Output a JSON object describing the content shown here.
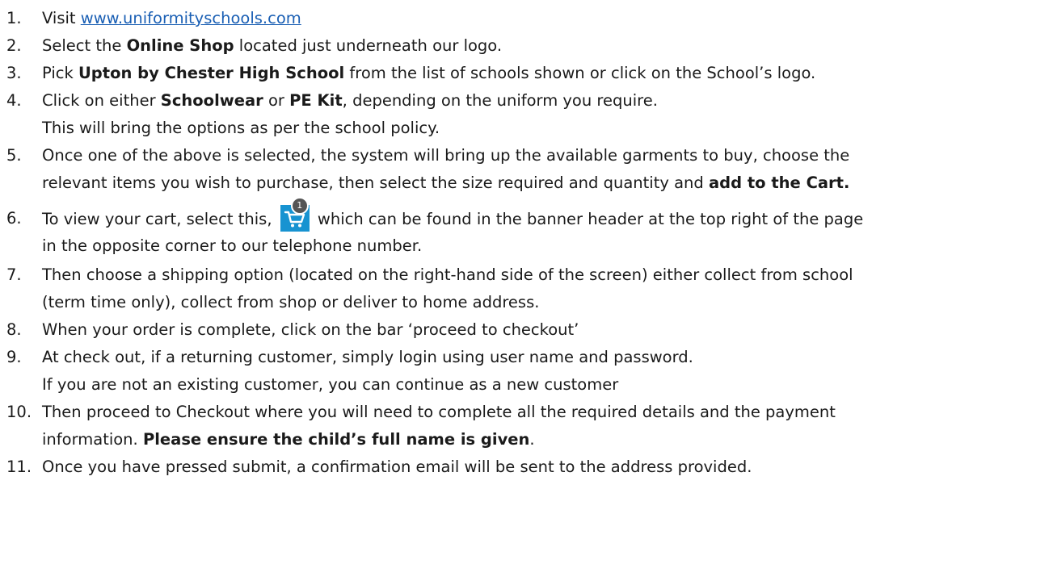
{
  "steps": [
    {
      "num": "1.",
      "pre": "Visit ",
      "link": "www.uniformityschools.com"
    },
    {
      "num": "2.",
      "pre": "Select the ",
      "bold": "Online Shop",
      "post": " located just underneath our logo."
    },
    {
      "num": "3.",
      "pre": "Pick ",
      "bold": "Upton by Chester High School",
      "post": " from the list of schools shown or click on the School’s logo."
    },
    {
      "num": "4.",
      "pre": "Click on either ",
      "bold1": "Schoolwear",
      "mid": " or ",
      "bold2": "PE Kit",
      "post": ", depending on the uniform you require.",
      "line2": "This will bring the options as per the school policy."
    },
    {
      "num": "5.",
      "line1": "Once one of the above is selected, the system will bring up the available garments to buy, choose the",
      "line2_pre": "relevant items you wish to purchase, then select the size required and quantity and ",
      "line2_bold": "add to the Cart."
    },
    {
      "num": "6.",
      "pre": "To view your cart, select this, ",
      "cart_badge": "1",
      "post": " which can be found in the banner header at the top right of the page",
      "line2": "in the opposite corner to our telephone number."
    },
    {
      "num": "7.",
      "line1": "Then choose a shipping option (located on the right-hand side of the screen) either collect from school",
      "line2": "(term time only), collect from shop or deliver to home address."
    },
    {
      "num": "8.",
      "line1": "When your order is complete, click on the bar ‘proceed to checkout’"
    },
    {
      "num": "9.",
      "line1": "At check out, if a returning customer, simply login using user name and password.",
      "line2": "If you are not an existing customer, you can continue as a new customer"
    },
    {
      "num": "10.",
      "line1": "Then proceed to Checkout where you will need to complete all the required details and the payment",
      "line2_pre": "information. ",
      "line2_bold": "Please ensure the child’s full name is given",
      "line2_post": "."
    },
    {
      "num": "11.",
      "line1": "Once you have pressed submit, a confirmation email will be sent to the address provided."
    }
  ],
  "colors": {
    "link": "#1a5fb4",
    "cart_icon_bg": "#1793d1",
    "badge_bg": "#555555",
    "text": "#1a1a1a"
  },
  "icons": {
    "cart": "shopping-cart-icon"
  }
}
